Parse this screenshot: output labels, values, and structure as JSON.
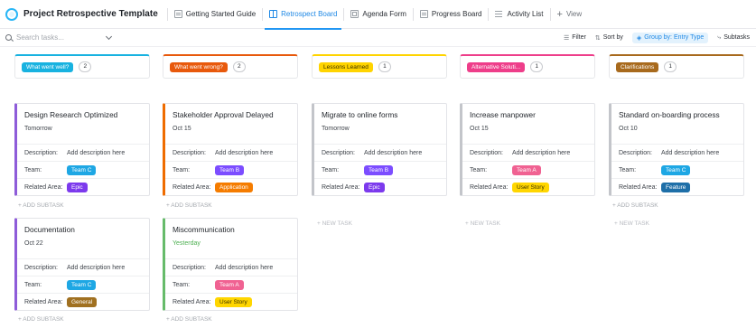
{
  "app": {
    "title": "Project Retrospective Template"
  },
  "tabs": [
    {
      "label": "Getting Started Guide",
      "active": false,
      "icon": "doc-icon"
    },
    {
      "label": "Retrospect Board",
      "active": true,
      "icon": "board-icon"
    },
    {
      "label": "Agenda Form",
      "active": false,
      "icon": "form-icon"
    },
    {
      "label": "Progress Board",
      "active": false,
      "icon": "board-icon"
    },
    {
      "label": "Activity List",
      "active": false,
      "icon": "list-icon"
    }
  ],
  "add_view_label": "View",
  "toolbar": {
    "search_placeholder": "Search tasks...",
    "filter_label": "Filter",
    "sort_label": "Sort by",
    "group_label": "Group by: Entry Type",
    "subtasks_label": "Subtasks"
  },
  "field_labels": {
    "description": "Description:",
    "team": "Team:",
    "related_area": "Related Area:",
    "add_description": "Add description here"
  },
  "add_subtask_label": "+ ADD SUBTASK",
  "new_task_label": "+ NEW TASK",
  "colors": {
    "accent": "#2196f3",
    "team_c": "#1ea7e4",
    "team_b": "#7c4dff",
    "team_a": "#f06292",
    "epic": "#7c3aed",
    "application": "#f57c00",
    "user_story": "#ffd600",
    "feature": "#1e6fa8",
    "general": "#a07020"
  },
  "columns": [
    {
      "label": "What went well?",
      "count": "2",
      "color": "#18b2e0",
      "cards": [
        {
          "title": "Design Research Optimized",
          "date": "Tomorrow",
          "team": "Team C",
          "area": "Epic",
          "accent": "#8e5cd9"
        },
        {
          "title": "Documentation",
          "date": "Oct 22",
          "team": "Team C",
          "area": "General",
          "accent": "#8e5cd9"
        }
      ]
    },
    {
      "label": "What went wrong?",
      "count": "2",
      "color": "#e8590c",
      "cards": [
        {
          "title": "Stakeholder Approval Delayed",
          "date": "Oct 15",
          "team": "Team B",
          "area": "Application",
          "accent": "#ef6c00"
        },
        {
          "title": "Miscommunication",
          "date": "Yesterday",
          "team": "Team A",
          "area": "User Story",
          "accent": "#66bb6a"
        }
      ]
    },
    {
      "label": "Lessons Learned",
      "count": "1",
      "color": "#ffd400",
      "cards": [
        {
          "title": "Migrate to online forms",
          "date": "Tomorrow",
          "team": "Team B",
          "area": "Epic",
          "accent": "#c3c5ca"
        }
      ]
    },
    {
      "label": "Alternative Soluti...",
      "count": "1",
      "color": "#ee3e8a",
      "cards": [
        {
          "title": "Increase manpower",
          "date": "Oct 15",
          "team": "Team A",
          "area": "User Story",
          "accent": "#c3c5ca"
        }
      ]
    },
    {
      "label": "Clarifications",
      "count": "1",
      "color": "#a86a1d",
      "cards": [
        {
          "title": "Standard on-boarding process",
          "date": "Oct 10",
          "team": "Team C",
          "area": "Feature",
          "accent": "#c3c5ca"
        }
      ]
    }
  ]
}
